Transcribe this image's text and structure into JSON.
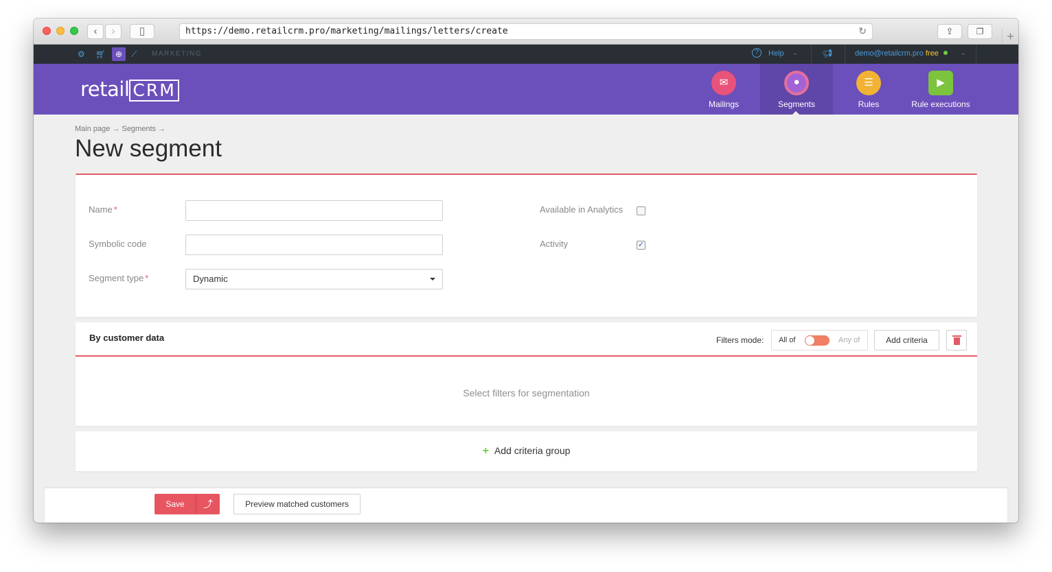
{
  "browser": {
    "url": "https://demo.retailcrm.pro/marketing/mailings/letters/create"
  },
  "topbar": {
    "section": "MARKETING",
    "help": "Help",
    "user_email": "demo@retailcrm.pro",
    "plan": "free"
  },
  "header": {
    "logo_prefix": "retail",
    "logo_box": "CRM",
    "nav": [
      {
        "label": "Mailings",
        "icon": "mailings-icon",
        "active": false
      },
      {
        "label": "Segments",
        "icon": "segments-icon",
        "active": true
      },
      {
        "label": "Rules",
        "icon": "rules-icon",
        "active": false
      },
      {
        "label": "Rule executions",
        "icon": "rule-executions-icon",
        "active": false
      }
    ]
  },
  "breadcrumb": "Main page → Segments →",
  "page_title": "New segment",
  "form": {
    "name_label": "Name",
    "name_value": "",
    "code_label": "Symbolic code",
    "code_value": "",
    "type_label": "Segment type",
    "type_value": "Dynamic",
    "analytics_label": "Available in Analytics",
    "analytics_checked": false,
    "activity_label": "Activity",
    "activity_checked": true,
    "required_mark": "*"
  },
  "criteria": {
    "title": "By customer data",
    "filters_mode_label": "Filters mode:",
    "mode_all": "All of",
    "mode_any": "Any of",
    "add_criteria": "Add criteria",
    "empty_text": "Select filters for segmentation"
  },
  "add_group": {
    "label": "Add criteria group"
  },
  "footer": {
    "save": "Save",
    "preview": "Preview matched customers"
  },
  "colors": {
    "header_purple": "#6b4fbb",
    "accent_red": "#e25a64",
    "link_blue": "#4a9ad8"
  }
}
